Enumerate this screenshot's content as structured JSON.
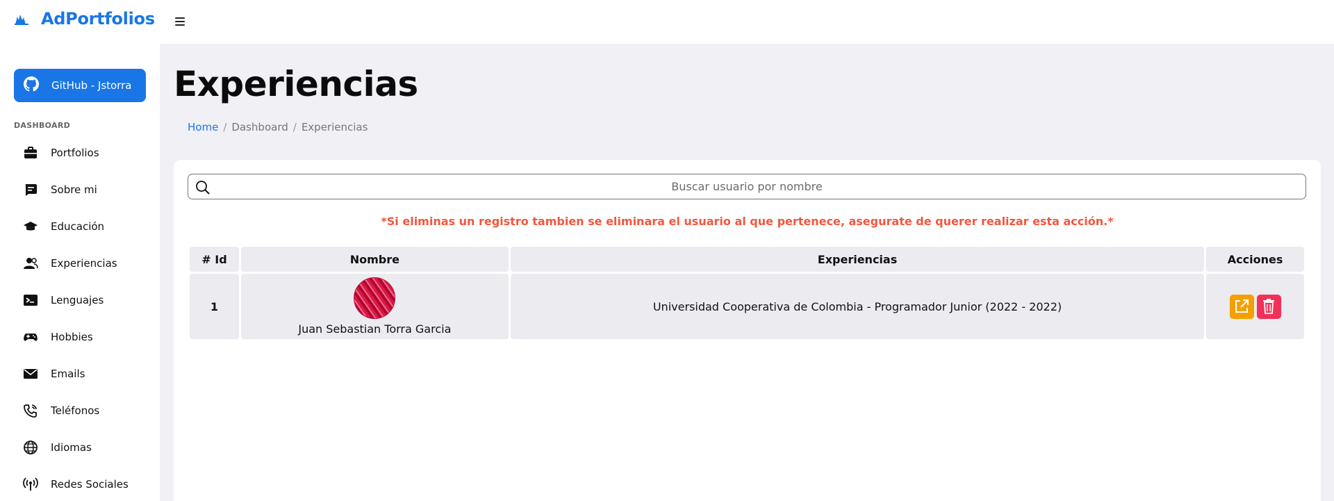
{
  "app": {
    "brand": "AdPortfolios",
    "accent_color": "#1a76e6"
  },
  "sidebar": {
    "github_button": {
      "label": "GitHub - Jstorra",
      "icon": "github-icon"
    },
    "section_label": "DASHBOARD",
    "items": [
      {
        "label": "Portfolios",
        "icon": "briefcase-icon"
      },
      {
        "label": "Sobre mi",
        "icon": "chat-square-icon"
      },
      {
        "label": "Educación",
        "icon": "graduation-cap-icon"
      },
      {
        "label": "Experiencias",
        "icon": "people-icon"
      },
      {
        "label": "Lenguajes",
        "icon": "terminal-icon"
      },
      {
        "label": "Hobbies",
        "icon": "gamepad-icon"
      },
      {
        "label": "Emails",
        "icon": "envelope-icon"
      },
      {
        "label": "Teléfonos",
        "icon": "phone-icon"
      },
      {
        "label": "Idiomas",
        "icon": "globe-icon"
      },
      {
        "label": "Redes Sociales",
        "icon": "broadcast-icon"
      }
    ]
  },
  "main": {
    "title": "Experiencias",
    "breadcrumb": [
      "Home",
      "Dashboard",
      "Experiencias"
    ],
    "search": {
      "placeholder": "Buscar usuario por nombre",
      "value": ""
    },
    "warning": "*Si eliminas un registro tambien se eliminara el usuario al que pertenece, asegurate de querer realizar esta acción.*",
    "table": {
      "headers": [
        "# Id",
        "Nombre",
        "Experiencias",
        "Acciones"
      ],
      "rows": [
        {
          "id": "1",
          "name": "Juan Sebastian Torra Garcia",
          "experiences": "Universidad Cooperativa de Colombia - Programador Junior (2022 - 2022)"
        }
      ]
    },
    "colors": {
      "warning": "#f2573d",
      "edit_button": "#f5a000",
      "delete_button": "#f0315a"
    }
  }
}
